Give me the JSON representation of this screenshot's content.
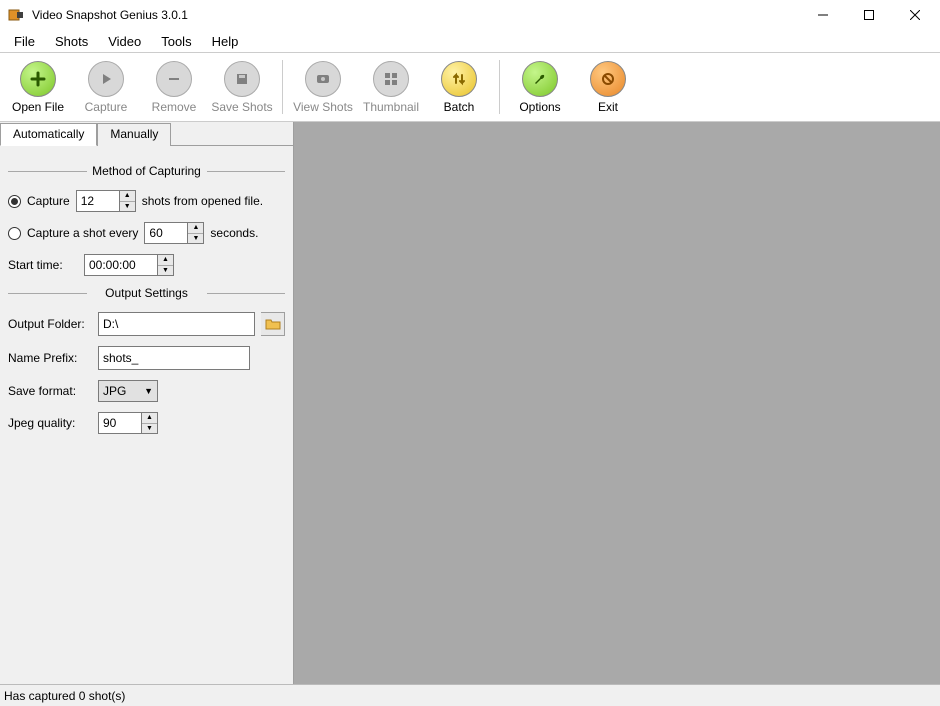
{
  "title": "Video Snapshot Genius 3.0.1",
  "menu": [
    "File",
    "Shots",
    "Video",
    "Tools",
    "Help"
  ],
  "toolbar": [
    {
      "label": "Open File",
      "icon": "plus",
      "color": "green",
      "enabled": true
    },
    {
      "label": "Capture",
      "icon": "play",
      "color": "gray",
      "enabled": false
    },
    {
      "label": "Remove",
      "icon": "minus",
      "color": "gray",
      "enabled": false
    },
    {
      "label": "Save Shots",
      "icon": "disk",
      "color": "gray",
      "enabled": false
    },
    {
      "sep": true
    },
    {
      "label": "View Shots",
      "icon": "eye",
      "color": "gray",
      "enabled": false
    },
    {
      "label": "Thumbnail",
      "icon": "grid",
      "color": "gray",
      "enabled": false
    },
    {
      "label": "Batch",
      "icon": "arrows",
      "color": "yellow",
      "enabled": true
    },
    {
      "sep": true
    },
    {
      "label": "Options",
      "icon": "wrench",
      "color": "green",
      "enabled": true
    },
    {
      "label": "Exit",
      "icon": "x",
      "color": "orange",
      "enabled": true
    }
  ],
  "tabs": {
    "auto": "Automatically",
    "manual": "Manually"
  },
  "groups": {
    "capture": "Method of Capturing",
    "output": "Output Settings"
  },
  "capture": {
    "radio1_pre": "Capture",
    "radio1_count": "12",
    "radio1_post": "shots from opened file.",
    "radio2_pre": "Capture a shot every",
    "radio2_seconds": "60",
    "radio2_post": "seconds.",
    "start_time_label": "Start time:",
    "start_time_value": "00:00:00"
  },
  "output": {
    "folder_label": "Output Folder:",
    "folder_value": "D:\\",
    "prefix_label": "Name Prefix:",
    "prefix_value": "shots_",
    "format_label": "Save format:",
    "format_value": "JPG",
    "quality_label": "Jpeg quality:",
    "quality_value": "90"
  },
  "status": "Has captured 0 shot(s)"
}
